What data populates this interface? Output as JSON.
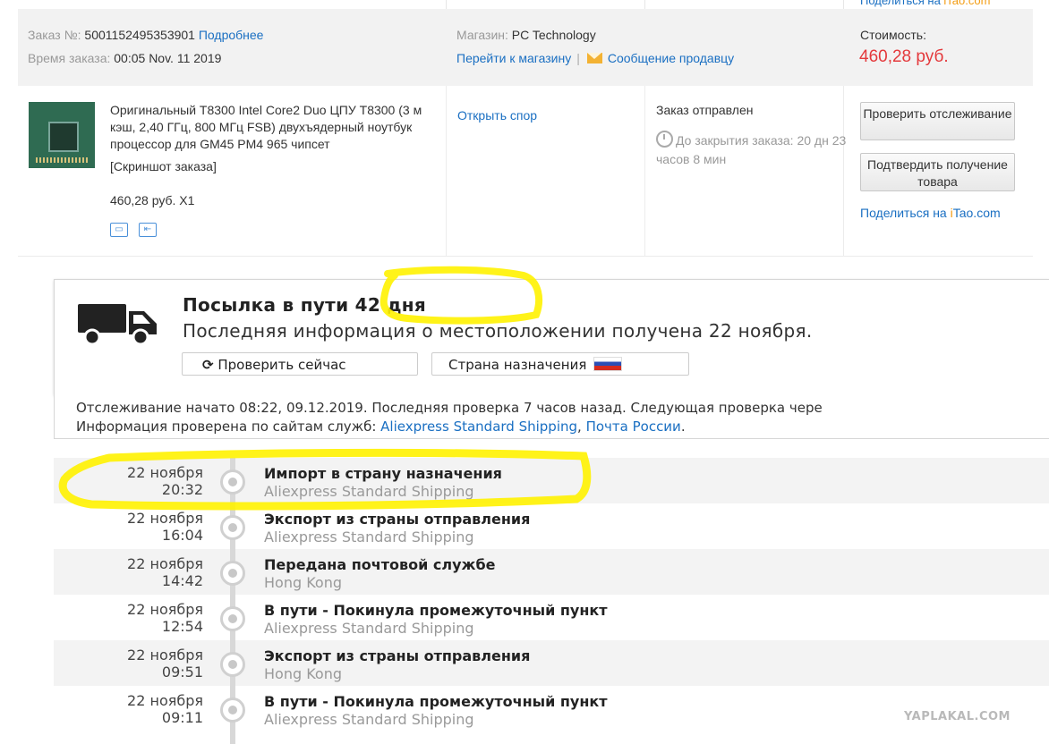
{
  "top_strip": {
    "share_prefix": "Поделиться на ",
    "share_brand": "iTao.com"
  },
  "order": {
    "id_label": "Заказ №:",
    "id_value": "5001152495353901",
    "details_link": "Подробнее",
    "time_label": "Время заказа:",
    "time_value": "00:05 Nov. 11 2019",
    "shop_label": "Магазин:",
    "shop_value": "PC Technology",
    "go_to_shop": "Перейти к магазину",
    "separator": "|",
    "message_seller": "Сообщение продавцу",
    "cost_label": "Стоимость:",
    "cost_value": "460,28 руб."
  },
  "product": {
    "title": "Оригинальный T8300 Intel Core2 Duo ЦПУ T8300 (3 м кэш, 2,40 ГГц, 800 МГц FSB) двухъядерный ноутбук процессор для GM45 PM4 965 чипсет",
    "screenshot_link": "[Скриншот заказа]",
    "price_qty": "460,28 руб. X1",
    "open_dispute": "Открыть спор",
    "status": "Заказ отправлен",
    "timer": "До закрытия заказа: 20 дн 23 часов 8 мин",
    "btn_track": "Проверить отслеживание",
    "btn_confirm": "Подтвердить получение товара",
    "share_prefix": "Поделиться на ",
    "share_i": "i",
    "share_rest": "Tao.com"
  },
  "tracking": {
    "title": "Посылка в пути 42 дня",
    "subtitle": "Последняя информация о местоположении получена 22 ноября.",
    "btn_check": "Проверить сейчас",
    "btn_destination": "Страна назначения",
    "info_line1": "Отслеживание начато 08:22, 09.12.2019. Последняя проверка 7 часов назад. Следующая проверка чере",
    "info_line2_prefix": "Информация проверена по сайтам служб: ",
    "info_link1": "Aliexpress Standard Shipping",
    "info_comma": ", ",
    "info_link2": "Почта России",
    "info_period": "."
  },
  "timeline": [
    {
      "date": "22 ноября",
      "time": "20:32",
      "event": "Импорт в страну назначения",
      "carrier": "Aliexpress Standard Shipping"
    },
    {
      "date": "22 ноября",
      "time": "16:04",
      "event": "Экспорт из страны отправления",
      "carrier": "Aliexpress Standard Shipping"
    },
    {
      "date": "22 ноября",
      "time": "14:42",
      "event": "Передана почтовой службе",
      "carrier": "Hong Kong"
    },
    {
      "date": "22 ноября",
      "time": "12:54",
      "event": "В пути - Покинула промежуточный пункт",
      "carrier": "Aliexpress Standard Shipping"
    },
    {
      "date": "22 ноября",
      "time": "09:51",
      "event": "Экспорт из страны отправления",
      "carrier": "Hong Kong"
    },
    {
      "date": "22 ноября",
      "time": "09:11",
      "event": "В пути - Покинула промежуточный пункт",
      "carrier": "Aliexpress Standard Shipping"
    }
  ],
  "watermark": "YAPLAKAL.COM",
  "colors": {
    "link": "#1a6fc2",
    "price": "#e4393c",
    "highlight": "#fff200"
  }
}
